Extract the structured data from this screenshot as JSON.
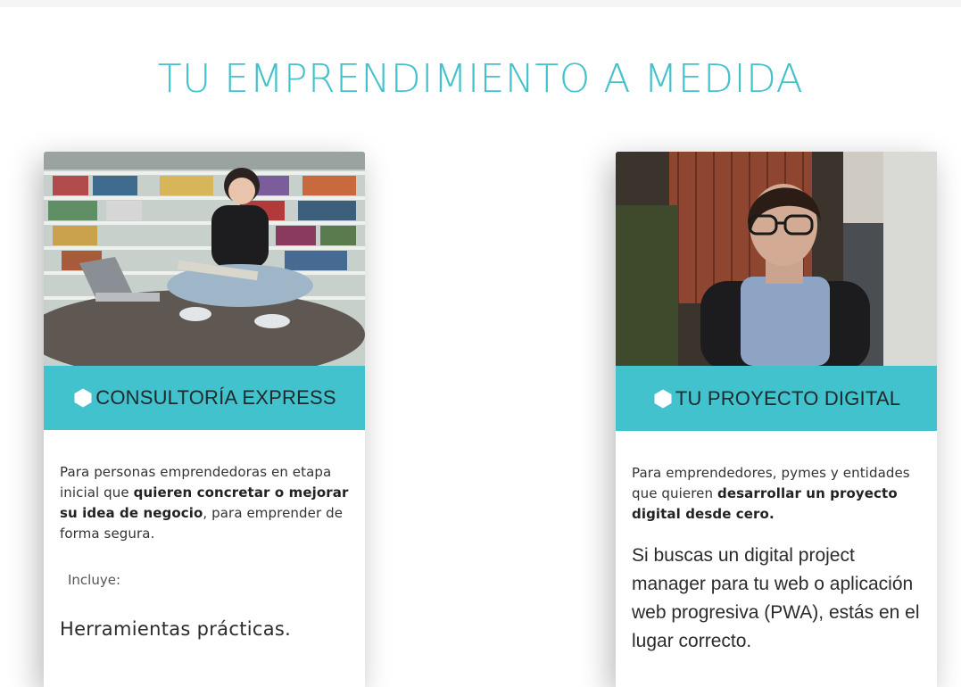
{
  "page": {
    "title": "TU EMPRENDIMIENTO A MEDIDA"
  },
  "cards": [
    {
      "title": "CONSULTORÍA EXPRESS",
      "description_parts": [
        "Para personas emprendedoras en etapa inicial que ",
        "quieren concretar o mejorar su idea de negocio",
        ", para emprender de forma segura."
      ],
      "includes_label": "Incluye:",
      "feature": "Herramientas prácticas."
    },
    {
      "title": "TU PROYECTO DIGITAL",
      "description_parts": [
        "Para emprendedores, pymes y entidades que quieren ",
        "desarrollar un proyecto digital desde cero."
      ],
      "pitch": "Si buscas un digital project manager para tu web o aplicación web progresiva (PWA), estás en el lugar correcto."
    }
  ],
  "colors": {
    "accent": "#42c2cc",
    "title": "#43c1cc"
  },
  "icons": {
    "title_marker": "hexagon-icon"
  }
}
